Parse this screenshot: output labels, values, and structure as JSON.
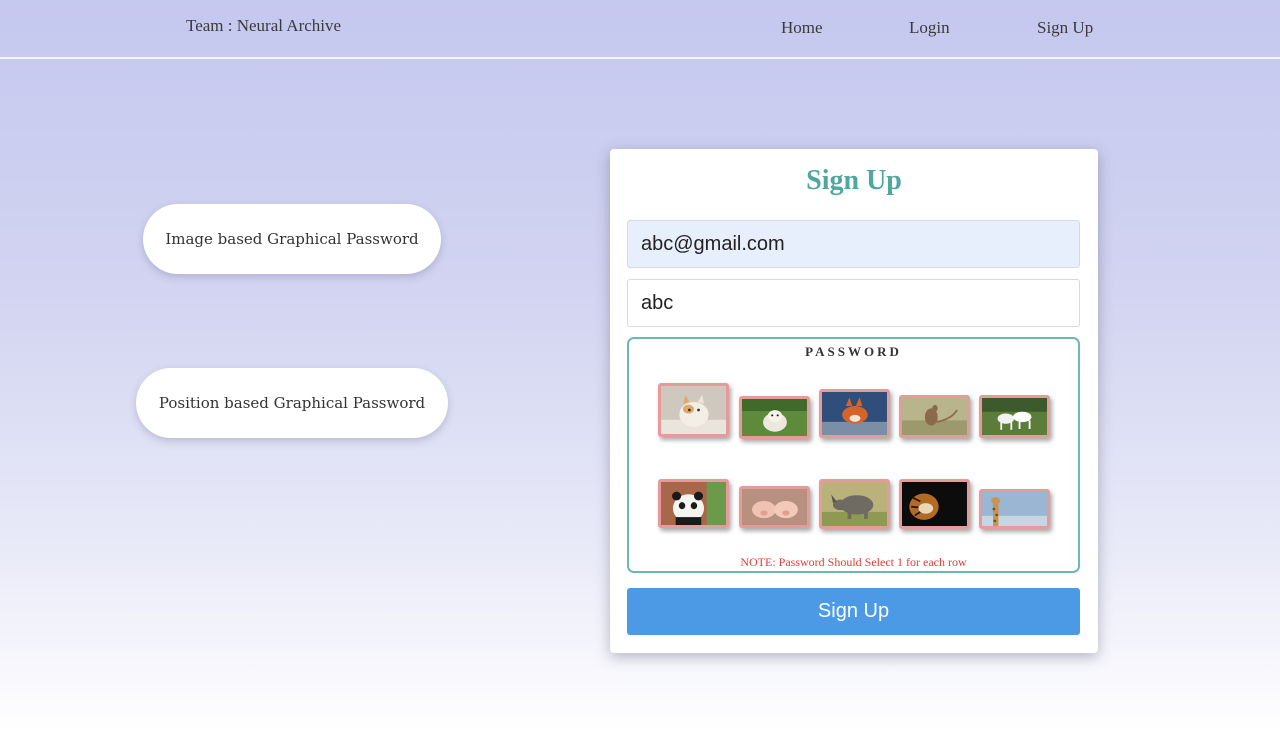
{
  "nav": {
    "brand": "Team : Neural Archive",
    "links": [
      "Home",
      "Login",
      "Sign Up"
    ]
  },
  "options": {
    "image_based": "Image based Graphical Password",
    "position_based": "Position based Graphical Password"
  },
  "form": {
    "title": "Sign Up",
    "email_value": "abc@gmail.com",
    "name_value": "abc",
    "password_label": "PASSWORD",
    "note": "NOTE: Password Should Select 1 for each row",
    "submit_label": "Sign Up"
  },
  "password_images": {
    "row1": [
      "cat-image",
      "dog-image",
      "fox-image",
      "kangaroo-image",
      "horses-image"
    ],
    "row2": [
      "panda-image",
      "pigs-image",
      "rhino-image",
      "tiger-image",
      "giraffe-image"
    ]
  },
  "colors": {
    "accent_teal": "#4fa8a0",
    "button_blue": "#4c9ae6",
    "note_red": "#e03c3c",
    "thumb_border": "#e79a9a"
  }
}
